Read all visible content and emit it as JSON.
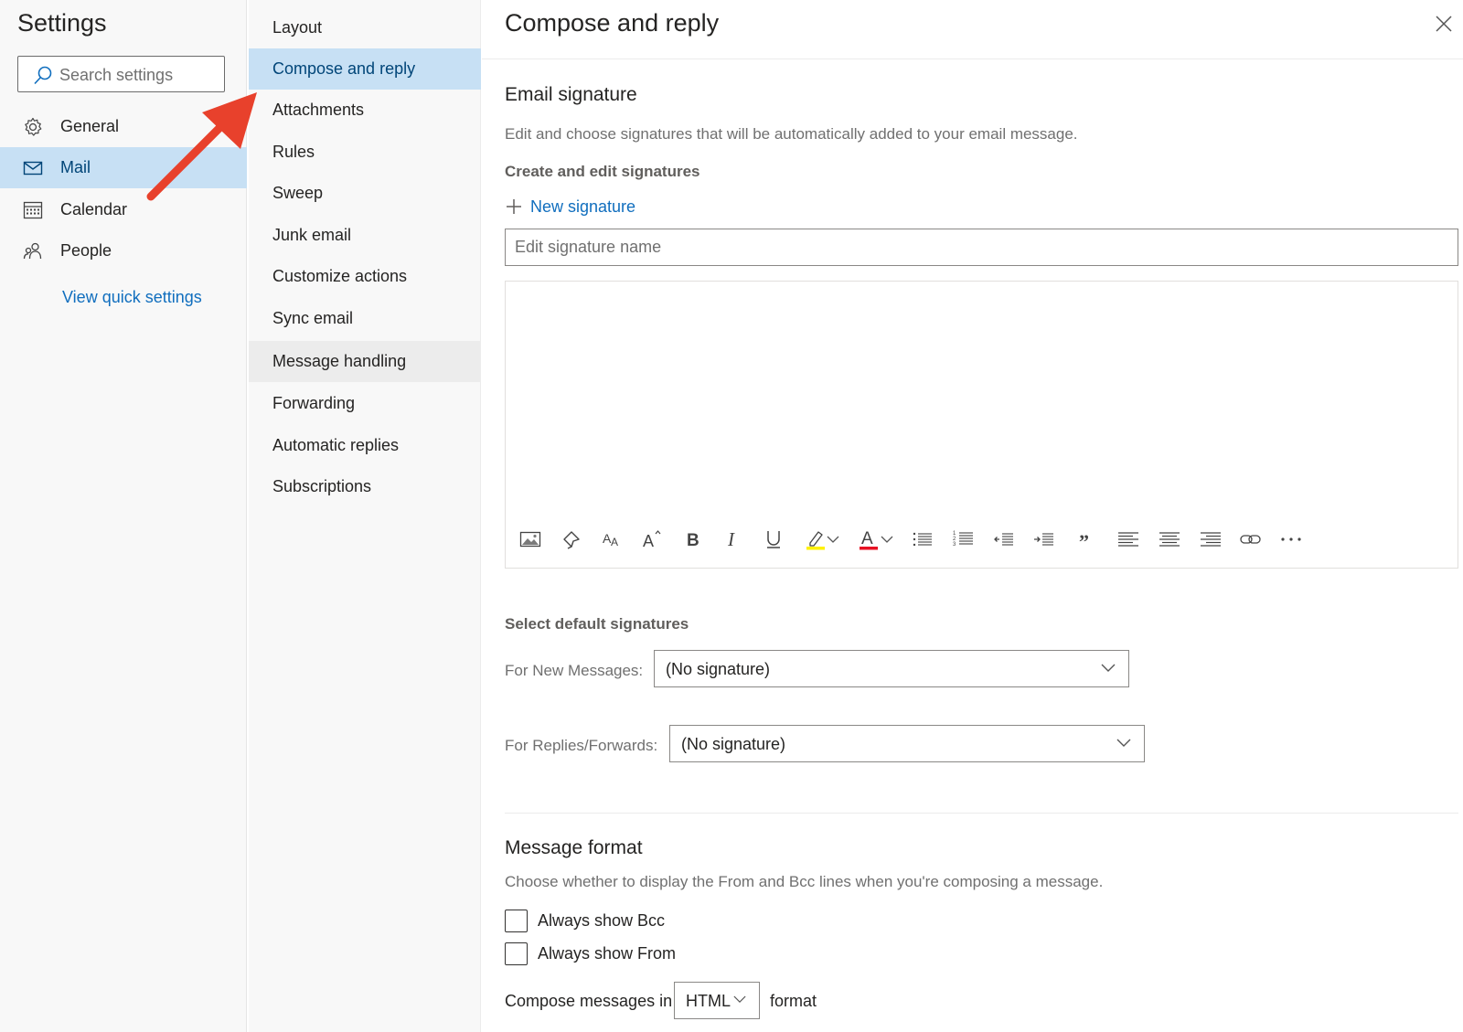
{
  "left": {
    "title": "Settings",
    "search_placeholder": "Search settings",
    "items": [
      {
        "label": "General",
        "icon": "gear-icon"
      },
      {
        "label": "Mail",
        "icon": "mail-icon",
        "selected": true
      },
      {
        "label": "Calendar",
        "icon": "calendar-icon"
      },
      {
        "label": "People",
        "icon": "people-icon"
      }
    ],
    "quick_settings_link": "View quick settings"
  },
  "middle": {
    "items": [
      {
        "label": "Layout"
      },
      {
        "label": "Compose and reply",
        "selected": true
      },
      {
        "label": "Attachments"
      },
      {
        "label": "Rules"
      },
      {
        "label": "Sweep"
      },
      {
        "label": "Junk email"
      },
      {
        "label": "Customize actions"
      },
      {
        "label": "Sync email"
      },
      {
        "label": "Message handling",
        "hovered": true
      },
      {
        "label": "Forwarding"
      },
      {
        "label": "Automatic replies"
      },
      {
        "label": "Subscriptions"
      }
    ]
  },
  "main": {
    "title": "Compose and reply",
    "signature": {
      "heading": "Email signature",
      "description": "Edit and choose signatures that will be automatically added to your email message.",
      "create_heading": "Create and edit signatures",
      "new_signature_label": "New signature",
      "name_placeholder": "Edit signature name",
      "toolbar_icons": [
        "insert-picture-icon",
        "format-painter-icon",
        "font-icon",
        "font-size-icon",
        "bold-icon",
        "italic-icon",
        "underline-icon",
        "highlight-icon",
        "highlight-dropdown-icon",
        "font-color-icon",
        "font-color-dropdown-icon",
        "bullets-icon",
        "numbering-icon",
        "decrease-indent-icon",
        "increase-indent-icon",
        "quote-icon",
        "align-left-icon",
        "align-center-icon",
        "align-right-icon",
        "link-icon",
        "more-options-icon"
      ]
    },
    "defaults": {
      "heading": "Select default signatures",
      "new_messages_label": "For New Messages:",
      "new_messages_value": "(No signature)",
      "replies_label": "For Replies/Forwards:",
      "replies_value": "(No signature)"
    },
    "format": {
      "heading": "Message format",
      "description": "Choose whether to display the From and Bcc lines when you're composing a message.",
      "always_bcc_label": "Always show Bcc",
      "always_bcc_checked": false,
      "always_from_label": "Always show From",
      "always_from_checked": false,
      "compose_prefix": "Compose messages in",
      "compose_format_value": "HTML",
      "compose_suffix": "format"
    }
  },
  "colors": {
    "accent": "#106ebe",
    "selection": "#c7e0f4",
    "annotation_arrow": "#e8412c",
    "highlight_swatch": "#fff100",
    "font_color_swatch": "#e81123"
  }
}
